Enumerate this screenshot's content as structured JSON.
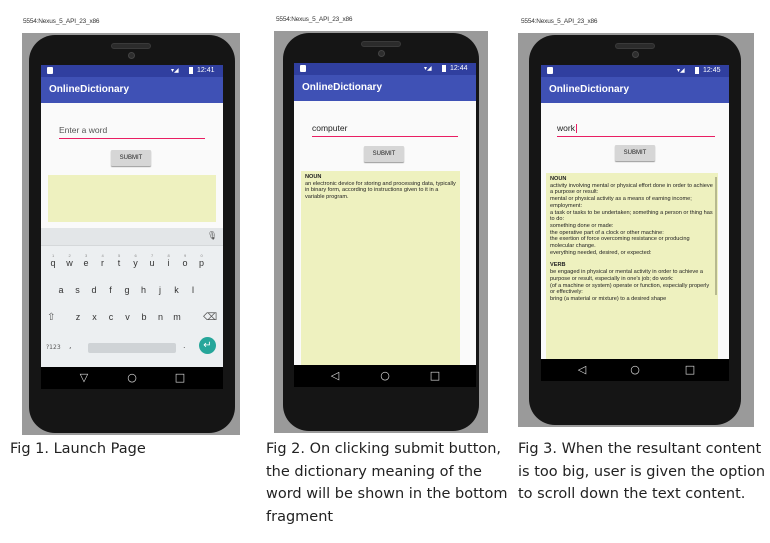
{
  "emulator_label": "5554:Nexus_5_API_23_x86",
  "app_title": "OnlineDictionary",
  "submit_label": "SUBMIT",
  "panels": [
    {
      "time": "12:41",
      "input_value": "",
      "input_placeholder": "Enter a word",
      "caption": "Fig 1. Launch Page"
    },
    {
      "time": "12:44",
      "input_value": "computer",
      "result": {
        "pos": "NOUN",
        "definitions": [
          "an electronic device for storing and processing data, typically in binary form, according to instructions given to it in a variable program."
        ]
      },
      "caption": "Fig 2. On clicking submit button, the dictionary meaning of the word will be shown in the bottom fragment"
    },
    {
      "time": "12:45",
      "input_value": "work",
      "result": {
        "sections": [
          {
            "pos": "NOUN",
            "definitions": [
              "activity involving mental or physical effort done in order to achieve a purpose or result:",
              "mental or physical activity as a means of earning income; employment:",
              "a task or tasks to be undertaken; something a person or thing has to do:",
              "something done or made:",
              "the operative part of a clock or other machine:",
              "the exertion of force overcoming resistance or producing molecular change.",
              "everything needed, desired, or expected:"
            ]
          },
          {
            "pos": "VERB",
            "definitions": [
              "be engaged in physical or mental activity in order to achieve a purpose or result, especially in one's job; do work:",
              "(of a machine or system) operate or function, especially properly or effectively:",
              "bring (a material or mixture) to a desired shape"
            ]
          }
        ]
      },
      "caption": "Fig 3. When the resultant content is too big, user is given the option to scroll down the text content."
    }
  ],
  "keyboard": {
    "numbers": [
      "1",
      "2",
      "3",
      "4",
      "5",
      "6",
      "7",
      "8",
      "9",
      "0"
    ],
    "row1": [
      "q",
      "w",
      "e",
      "r",
      "t",
      "y",
      "u",
      "i",
      "o",
      "p"
    ],
    "row2": [
      "a",
      "s",
      "d",
      "f",
      "g",
      "h",
      "j",
      "k",
      "l"
    ],
    "row3": [
      "z",
      "x",
      "c",
      "v",
      "b",
      "n",
      "m"
    ],
    "sym_label": "?123",
    "comma": ",",
    "period": "."
  },
  "icons": [
    "notification-icon",
    "signal-icon",
    "battery-icon",
    "mic-icon",
    "shift-icon",
    "backspace-icon",
    "enter-icon",
    "back-icon",
    "home-icon",
    "recents-icon"
  ]
}
